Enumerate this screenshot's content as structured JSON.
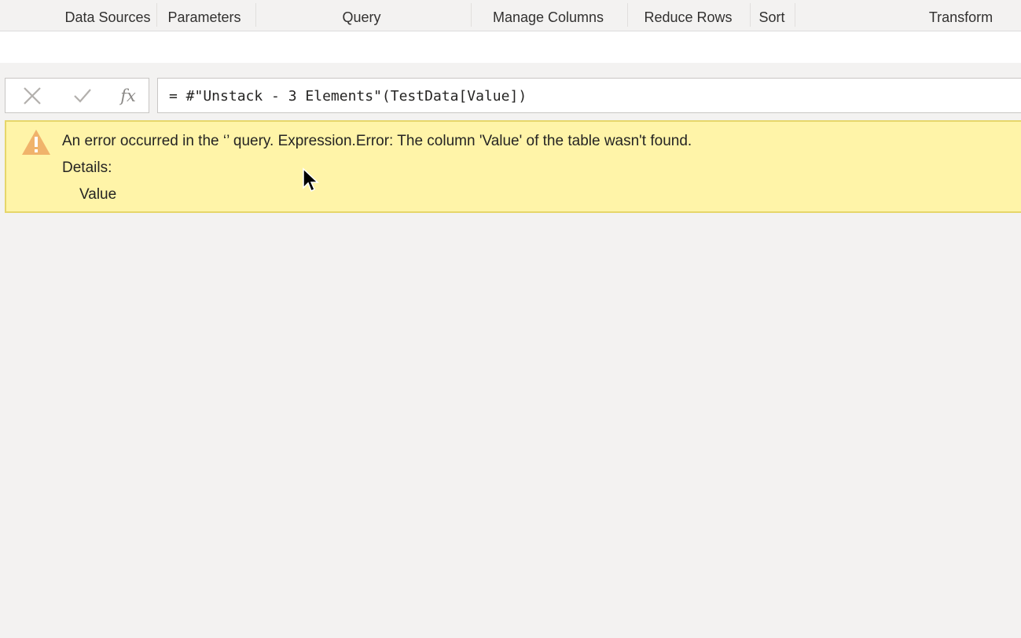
{
  "ribbon": {
    "groups": [
      "Data Sources",
      "Parameters",
      "Query",
      "Manage Columns",
      "Reduce Rows",
      "Sort",
      "Transform"
    ]
  },
  "formula_bar": {
    "cancel_icon": "x-icon",
    "commit_icon": "check-icon",
    "fx_label": "fx",
    "formula": "= #\"Unstack - 3 Elements\"(TestData[Value])"
  },
  "error": {
    "icon": "warning-icon",
    "message": "An error occurred in the ‘’ query. Expression.Error: The column 'Value' of the table wasn't found.",
    "details_label": "Details:",
    "details_value": "Value",
    "colors": {
      "background": "#fff4a8",
      "border": "#e6d66a",
      "icon": "#f0b36b"
    }
  }
}
